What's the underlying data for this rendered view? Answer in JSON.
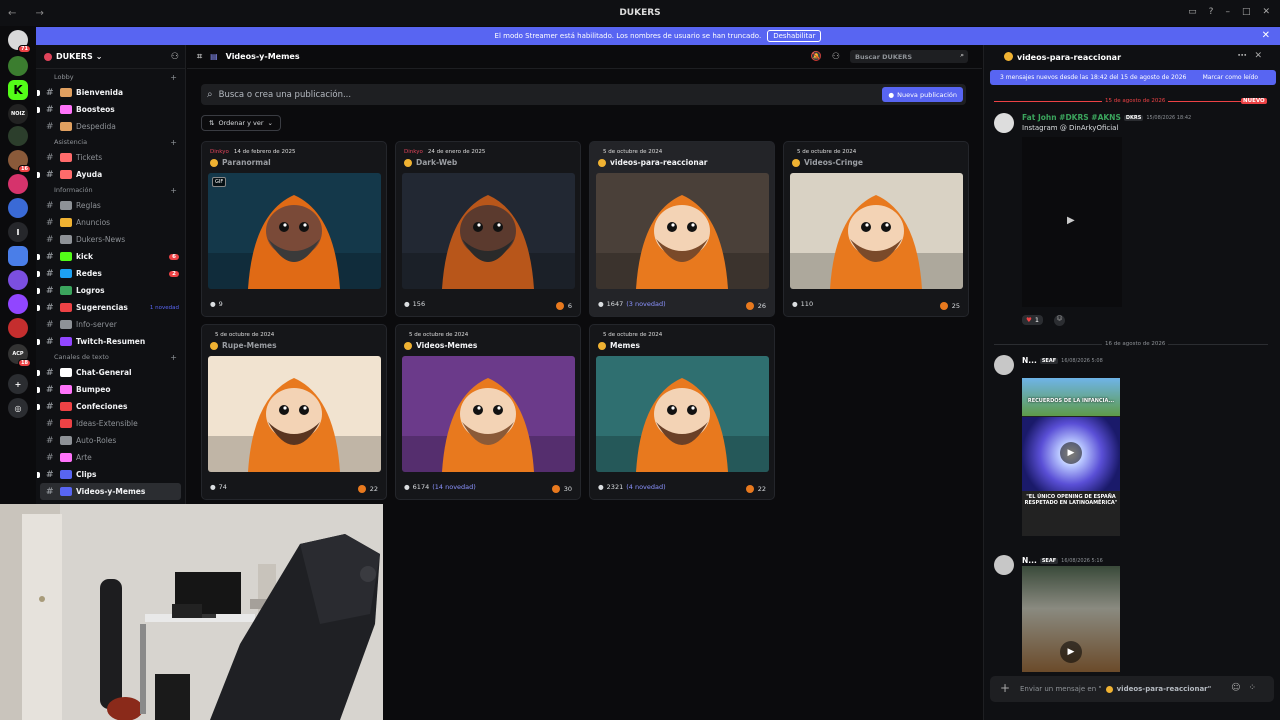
{
  "window": {
    "title": "DUKERS",
    "nav": "← →"
  },
  "banner": {
    "text": "El modo Streamer está habilitado. Los nombres de usuario se han truncado.",
    "button": "Deshabilitar"
  },
  "guilds": [
    {
      "label": "",
      "badge": "71",
      "color": "#d9d9d9"
    },
    {
      "label": "",
      "badge": "",
      "color": "#3b7d2f"
    },
    {
      "label": "K",
      "badge": "",
      "color": "#53fc18"
    },
    {
      "label": "NOIZ",
      "badge": "",
      "color": "#222222"
    },
    {
      "label": "",
      "badge": "",
      "color": "#2c3e2c"
    },
    {
      "label": "",
      "badge": "16",
      "color": "#8a5a3a"
    },
    {
      "label": "",
      "badge": "",
      "color": "#d6336c"
    },
    {
      "label": "",
      "badge": "",
      "color": "#3a6ad6"
    },
    {
      "label": "I",
      "badge": "",
      "color": "#26272b"
    },
    {
      "label": "",
      "badge": "",
      "color": "#4a7ee8"
    },
    {
      "label": "",
      "badge": "",
      "color": "#7b4fe0"
    },
    {
      "label": "",
      "badge": "",
      "color": "#9146ff"
    },
    {
      "label": "",
      "badge": "",
      "color": "#c52e2e"
    },
    {
      "label": "ACP",
      "badge": "18",
      "color": "#333333"
    }
  ],
  "server": {
    "name": "DUKERS"
  },
  "sidebar": [
    {
      "kind": "cat",
      "label": "Lobby"
    },
    {
      "kind": "ch",
      "label": "Bienvenida",
      "color": "#e0a060",
      "state": "bold"
    },
    {
      "kind": "ch",
      "label": "Boosteos",
      "color": "#ff73fa",
      "state": "bold"
    },
    {
      "kind": "ch",
      "label": "Despedida",
      "color": "#e0a060",
      "state": "muted"
    },
    {
      "kind": "cat",
      "label": "Asistencia"
    },
    {
      "kind": "ch",
      "label": "Tickets",
      "color": "#ff6b6b",
      "state": "muted"
    },
    {
      "kind": "ch",
      "label": "Ayuda",
      "color": "#ff6b6b",
      "state": "bold"
    },
    {
      "kind": "cat",
      "label": "Información"
    },
    {
      "kind": "ch",
      "label": "Reglas",
      "color": "#8e9297",
      "state": "muted"
    },
    {
      "kind": "ch",
      "label": "Anuncios",
      "color": "#f0b232",
      "state": "muted"
    },
    {
      "kind": "ch",
      "label": "Dukers-News",
      "color": "#8e9297",
      "state": "muted"
    },
    {
      "kind": "ch",
      "label": "kick",
      "color": "#53fc18",
      "state": "bold",
      "count": "6"
    },
    {
      "kind": "ch",
      "label": "Redes",
      "color": "#1da1f2",
      "state": "bold",
      "count": "2"
    },
    {
      "kind": "ch",
      "label": "Logros",
      "color": "#3ba55d",
      "state": "bold"
    },
    {
      "kind": "ch",
      "label": "Sugerencias",
      "color": "#ed4245",
      "state": "bold",
      "novedad": "1 novedad"
    },
    {
      "kind": "ch",
      "label": "Info-server",
      "color": "#8e9297",
      "state": "muted"
    },
    {
      "kind": "ch",
      "label": "Twitch-Resumen",
      "color": "#9146ff",
      "state": "bold"
    },
    {
      "kind": "cat",
      "label": "Canales de texto"
    },
    {
      "kind": "ch",
      "label": "Chat-General",
      "color": "#ffffff",
      "state": "bold"
    },
    {
      "kind": "ch",
      "label": "Bumpeo",
      "color": "#ff73fa",
      "state": "bold"
    },
    {
      "kind": "ch",
      "label": "Confeciones",
      "color": "#ed4245",
      "state": "bold"
    },
    {
      "kind": "ch",
      "label": "Ideas-Extensible",
      "color": "#ed4245",
      "state": "muted"
    },
    {
      "kind": "ch",
      "label": "Auto-Roles",
      "color": "#8e9297",
      "state": "muted"
    },
    {
      "kind": "ch",
      "label": "Arte",
      "color": "#ff73fa",
      "state": "muted"
    },
    {
      "kind": "ch",
      "label": "Clips",
      "color": "#5865f2",
      "state": "bold"
    },
    {
      "kind": "ch",
      "label": "Videos-y-Memes",
      "color": "#5865f2",
      "state": "sel"
    }
  ],
  "main": {
    "channel": "Videos-y-Memes",
    "search_placeholder": "Buscar DUKERS",
    "post_search": "Busca o crea una publicación...",
    "new_post": "Nueva publicación",
    "sort": "Ordenar y ver"
  },
  "posts": [
    {
      "author": "Dinkyo",
      "date": "14 de febrero de 2025",
      "title": "Paranormal",
      "muted": true,
      "comments": "9",
      "novedad": "",
      "reactions": "",
      "gif": "GIF",
      "bg": "#14384a",
      "hood": "#e06a15",
      "face": "#7a4a38",
      "beard": "#3a3a3a"
    },
    {
      "author": "Dinkyo",
      "date": "24 de enero de 2025",
      "title": "Dark-Web",
      "muted": true,
      "comments": "156",
      "novedad": "",
      "reactions": "6",
      "gif": "",
      "bg": "#222833",
      "hood": "#b8561a",
      "face": "#5b3a2e",
      "beard": "#2a2a2a"
    },
    {
      "author": "",
      "date": "5 de octubre de 2024",
      "title": "videos-para-reaccionar",
      "muted": false,
      "comments": "1647",
      "novedad": "(3 novedad)",
      "reactions": "26",
      "gif": "",
      "bg": "#4a4039",
      "hood": "#e8791e",
      "face": "#f3d3b5",
      "beard": "#7a4a2a"
    },
    {
      "author": "",
      "date": "5 de octubre de 2024",
      "title": "Videos-Cringe",
      "muted": true,
      "comments": "110",
      "novedad": "",
      "reactions": "25",
      "gif": "",
      "bg": "#d9d2c4",
      "hood": "#e8791e",
      "face": "#f3d3b5",
      "beard": "#7a4a2a"
    },
    {
      "author": "",
      "date": "5 de octubre de 2024",
      "title": "Rupe-Memes",
      "muted": true,
      "comments": "74",
      "novedad": "",
      "reactions": "22",
      "gif": "",
      "bg": "#f1e3d0",
      "hood": "#e8791e",
      "face": "#f3d3b5",
      "beard": "#5a3520"
    },
    {
      "author": "",
      "date": "5 de octubre de 2024",
      "title": "Videos-Memes",
      "muted": false,
      "comments": "6174",
      "novedad": "(14 novedad)",
      "reactions": "30",
      "gif": "",
      "bg": "#6b3a8a",
      "hood": "#e8791e",
      "face": "#f3d3b5",
      "beard": "#8a5a38"
    },
    {
      "author": "",
      "date": "5 de octubre de 2024",
      "title": "Memes",
      "muted": false,
      "comments": "2321",
      "novedad": "(4 novedad)",
      "reactions": "22",
      "gif": "",
      "bg": "#2f6f70",
      "hood": "#e8791e",
      "face": "#f3d3b5",
      "beard": "#6a4027"
    }
  ],
  "thread": {
    "title": "videos-para-reaccionar",
    "new_messages": "3 mensajes nuevos desde las 18:42 del 15 de agosto de 2026",
    "mark_read": "Marcar como leído",
    "date1": "15 de agosto de 2026",
    "nuevo": "NUEVO",
    "msg1_name": "Fat John #DKRS #AKNS",
    "msg1_tag": "DKRS",
    "msg1_time": "15/08/2026 18:42",
    "msg1_text": "Instagram @ DinArkyOficial",
    "reaction1": "1",
    "date2": "16 de agosto de 2026",
    "msg2_name": "N...",
    "msg2_tag": "SEAF",
    "msg2_time": "16/08/2026 5:08",
    "meme_top": "RECUERDOS DE LA INFANCIA...",
    "meme_bottom": "\"EL ÚNICO OPENING DE ESPAÑA RESPETADO EN LATINOAMÉRICA\"",
    "msg3_name": "N...",
    "msg3_tag": "SEAF",
    "msg3_time": "16/08/2026 5:16",
    "compose_prefix": "Enviar un mensaje en \"",
    "compose_channel": "videos-para-reaccionar\""
  }
}
